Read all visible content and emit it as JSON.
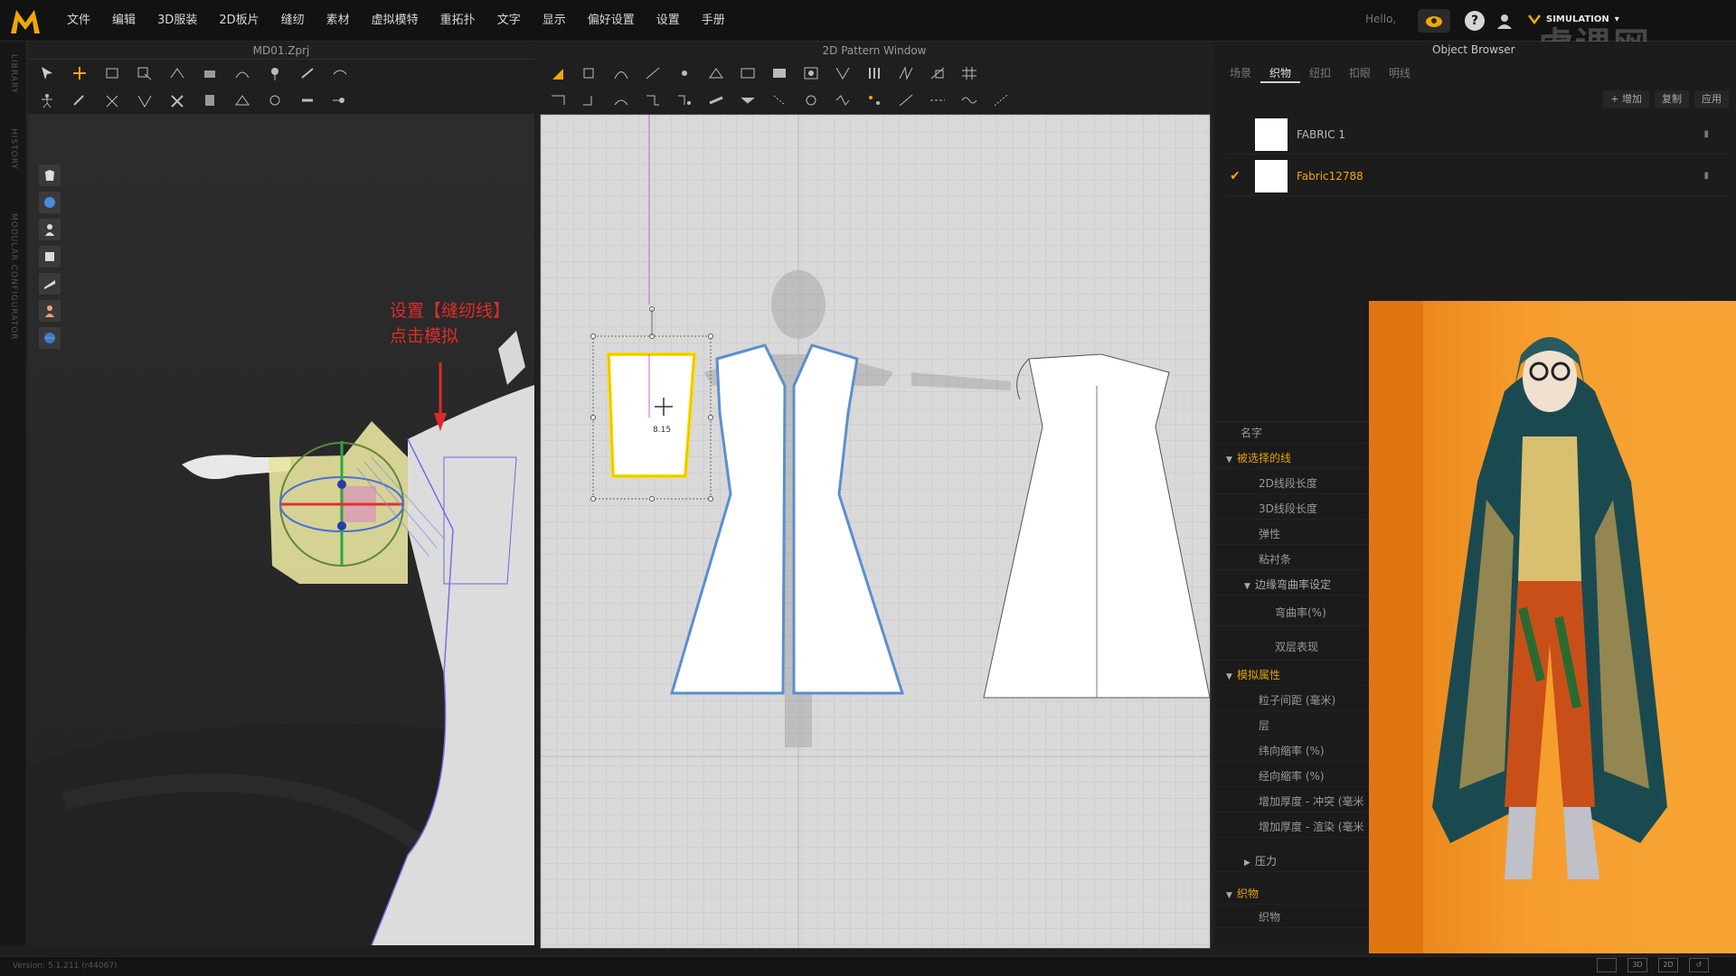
{
  "app": {
    "menu": [
      "文件",
      "编辑",
      "3D服装",
      "2D板片",
      "缝纫",
      "素材",
      "虚拟模特",
      "重拓扑",
      "文字",
      "显示",
      "偏好设置",
      "设置",
      "手册"
    ],
    "hello": "Hello,",
    "simulation_label": "SIMULATION",
    "watermark": "虎课网",
    "brand_color": "#f0a800"
  },
  "side_strip": {
    "labels": [
      "LIBRARY",
      "HISTORY",
      "MODULAR CONFIGURATOR"
    ]
  },
  "win3d": {
    "title": "MD01.Zprj",
    "annotation_line1": "设置【缝纫线】",
    "annotation_line2": "点击模拟"
  },
  "win2d": {
    "title": "2D Pattern Window",
    "measure_label": "8.15"
  },
  "object_browser": {
    "title": "Object Browser",
    "tabs": [
      "场景",
      "织物",
      "纽扣",
      "扣眼",
      "明线"
    ],
    "active_tab": "织物",
    "actions": [
      "+ 增加",
      "复制",
      "应用"
    ],
    "fabrics": [
      {
        "name": "FABRIC 1",
        "selected": false
      },
      {
        "name": "Fabric12788",
        "selected": true
      }
    ]
  },
  "property_editor": {
    "rows": [
      {
        "label": "名字",
        "type": "plain"
      },
      {
        "label": "被选择的线",
        "type": "section"
      },
      {
        "label": "2D线段长度",
        "type": "child"
      },
      {
        "label": "3D线段长度",
        "type": "child"
      },
      {
        "label": "弹性",
        "type": "child"
      },
      {
        "label": "粘衬条",
        "type": "child"
      },
      {
        "label": "边缘弯曲率设定",
        "type": "subsection"
      },
      {
        "label": "弯曲率(%)",
        "type": "grandchild"
      },
      {
        "label": "双层表现",
        "type": "grandchild"
      },
      {
        "label": "模拟属性",
        "type": "section"
      },
      {
        "label": "粒子间距 (毫米)",
        "type": "child"
      },
      {
        "label": "层",
        "type": "child"
      },
      {
        "label": "纬向缩率 (%)",
        "type": "child"
      },
      {
        "label": "经向缩率 (%)",
        "type": "child"
      },
      {
        "label": "增加厚度 - 冲突 (毫米",
        "type": "child"
      },
      {
        "label": "增加厚度 - 渲染 (毫米",
        "type": "child"
      },
      {
        "label": "压力",
        "type": "collapsed"
      },
      {
        "label": "织物",
        "type": "section"
      },
      {
        "label": "织物",
        "type": "child"
      }
    ]
  },
  "status": {
    "version": "Version: 5.1.211 (r44067)"
  },
  "view_buttons": [
    "",
    "3D",
    "2D",
    "↺"
  ]
}
